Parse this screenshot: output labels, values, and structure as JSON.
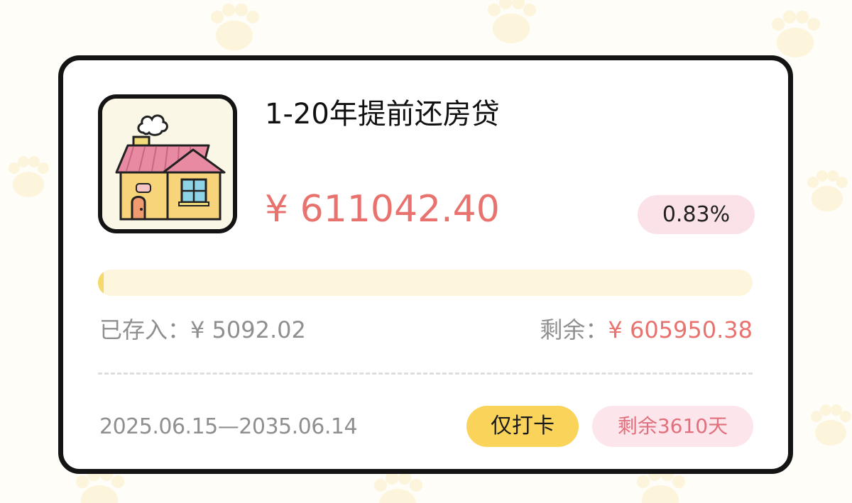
{
  "plan": {
    "title": "1-20年提前还房贷",
    "icon": "house-icon",
    "amount": "¥ 611042.40",
    "rate": "0.83%",
    "progress_fraction": 0.0083,
    "saved_label": "已存入：",
    "saved_value": "¥ 5092.02",
    "remaining_label": "剩余：",
    "remaining_value": "¥ 605950.38",
    "date_range": "2025.06.15—2035.06.14",
    "mode_badge": "仅打卡",
    "days_left": "剩余3610天"
  },
  "colors": {
    "accent": "#e8726e",
    "badge_pink": "#fbe2e8",
    "badge_yellow": "#f9d35a",
    "progress_track": "#fdf5dc",
    "progress_fill": "#f6d86b",
    "border": "#141414"
  }
}
